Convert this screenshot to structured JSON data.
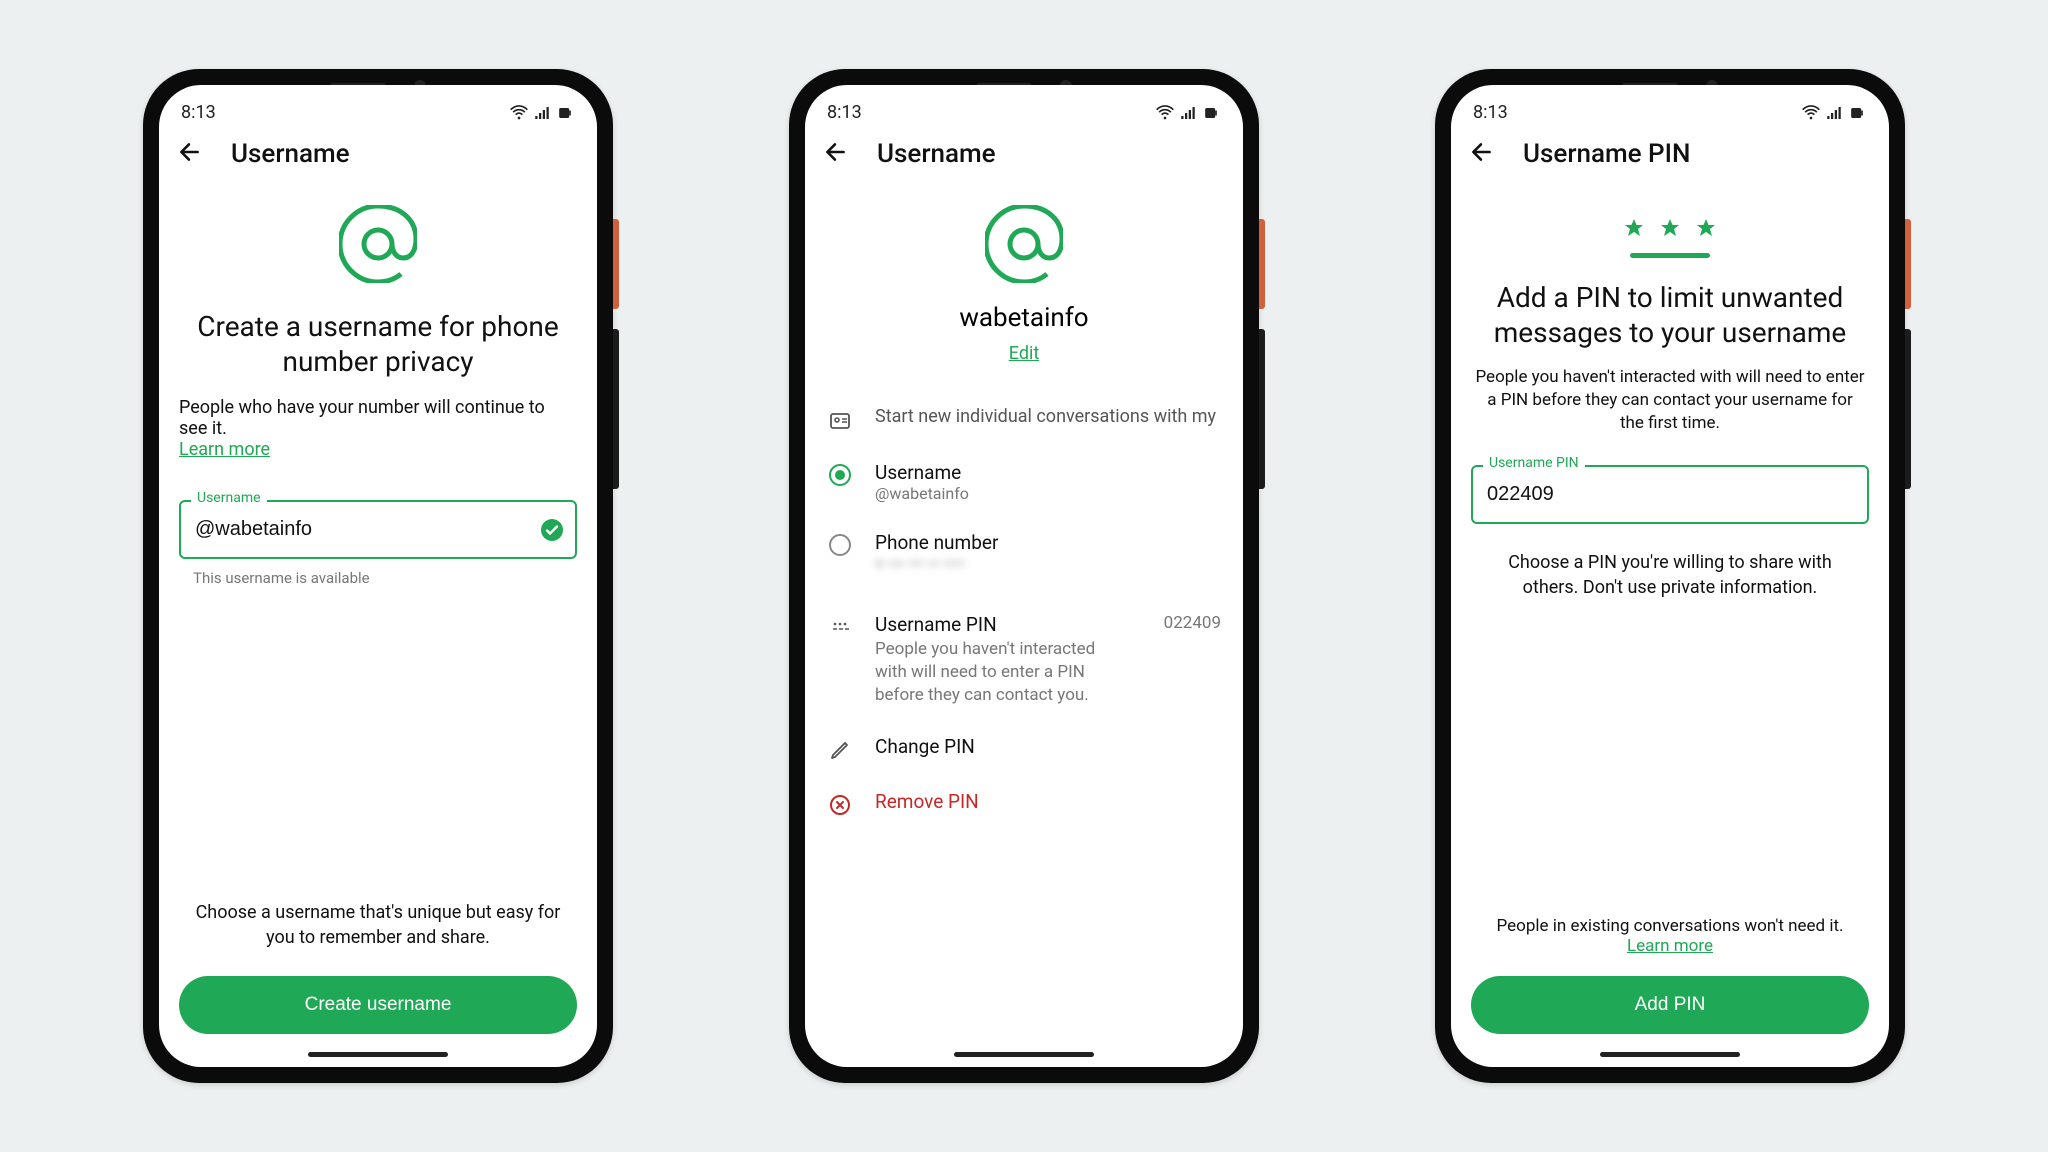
{
  "status": {
    "time": "8:13"
  },
  "screen1": {
    "title": "Username",
    "heading": "Create a username for phone number privacy",
    "sub": "People who have your number will continue to see it.",
    "learn": "Learn more",
    "field_label": "Username",
    "field_value": "@wabetainfo",
    "hint": "This username is available",
    "note": "Choose a username that's unique but easy for you to remember and share.",
    "button": "Create username"
  },
  "screen2": {
    "title": "Username",
    "profile": "wabetainfo",
    "edit": "Edit",
    "section": "Start new individual conversations with my",
    "opt_username": {
      "title": "Username",
      "sub": "@wabetainfo"
    },
    "opt_phone": {
      "title": "Phone number",
      "sub": "+ ••• ••• •• ••••"
    },
    "pin": {
      "title": "Username PIN",
      "desc": "People you haven't interacted with will need to enter a PIN before they can contact you.",
      "value": "022409"
    },
    "change": "Change PIN",
    "remove": "Remove PIN"
  },
  "screen3": {
    "title": "Username PIN",
    "heading": "Add a PIN to limit unwanted messages to your username",
    "sub": "People you haven't interacted with will need to enter a PIN before they can contact your username for the first time.",
    "field_label": "Username PIN",
    "field_value": "022409",
    "note": "Choose a PIN you're willing to share with others. Don't use private information.",
    "bottom": "People in existing conversations won't need it.",
    "learn": "Learn more",
    "button": "Add PIN"
  }
}
